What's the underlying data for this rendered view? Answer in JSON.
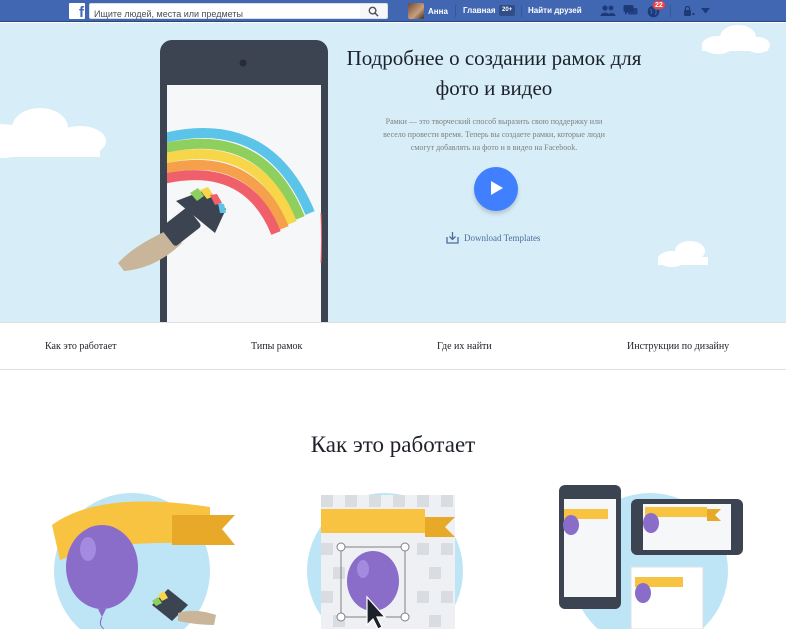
{
  "header": {
    "search_placeholder": "Ищите людей, места или предметы",
    "user_name": "Анна",
    "home_label": "Главная",
    "home_badge": "20+",
    "find_friends_label": "Найти друзей",
    "notifications_count": "22"
  },
  "hero": {
    "title_line1": "Подробнее о создании рамок для",
    "title_line2": "фото и видео",
    "desc_line1": "Рамки — это творческий способ выразить свою поддержку или",
    "desc_line2": "весело провести время. Теперь вы создаете рамки, которые люди",
    "desc_line3": "смогут добавлять на фото и в видео на Facebook.",
    "download_label": "Download Templates"
  },
  "section_nav": {
    "items": [
      "Как это работает",
      "Типы рамок",
      "Где их найти",
      "Инструкции по дизайну"
    ]
  },
  "how": {
    "title": "Как это работает"
  },
  "colors": {
    "brand_blue": "#4267b2",
    "hero_bg": "#d7eef9",
    "play_blue": "#4080ff",
    "badge_red": "#fa3e3e"
  }
}
